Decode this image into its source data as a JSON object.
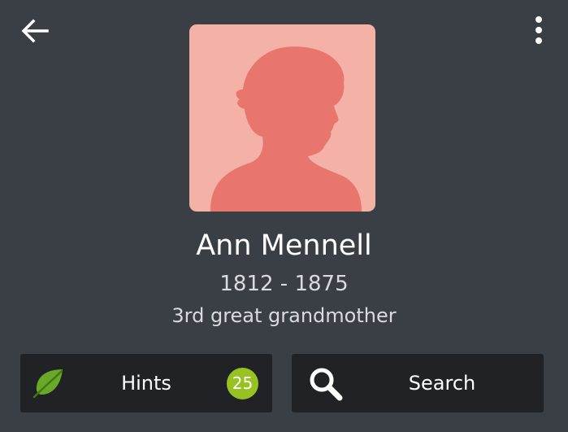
{
  "header": {
    "back_icon": "back-arrow-icon",
    "more_icon": "more-vertical-icon"
  },
  "profile": {
    "name": "Ann Mennell",
    "years": "1812 - 1875",
    "relationship": "3rd great grandmother",
    "avatar_icon": "female-silhouette-icon",
    "avatar_bg_color": "#f4b1a6",
    "avatar_fg_color": "#e8756e"
  },
  "actions": {
    "hints": {
      "label": "Hints",
      "count": "25",
      "icon": "leaf-icon",
      "badge_color": "#98c221"
    },
    "search": {
      "label": "Search",
      "icon": "search-icon"
    }
  },
  "colors": {
    "background": "#3a3e45",
    "button_bg": "#202226"
  }
}
